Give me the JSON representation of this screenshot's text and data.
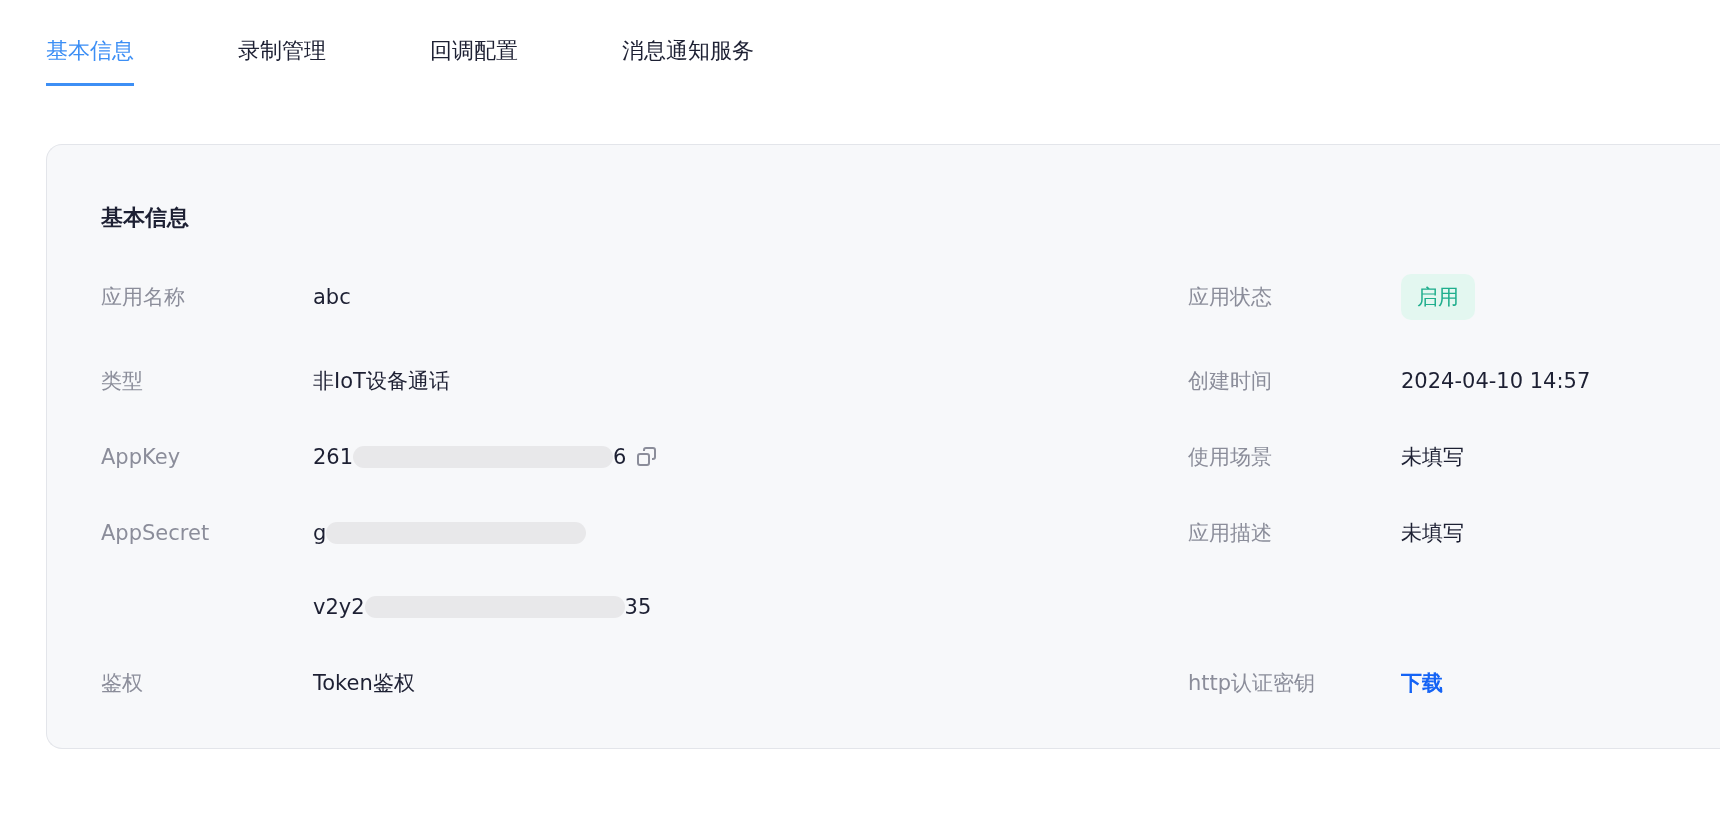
{
  "tabs": [
    {
      "label": "基本信息",
      "selected": true
    },
    {
      "label": "录制管理",
      "selected": false
    },
    {
      "label": "回调配置",
      "selected": false
    },
    {
      "label": "消息通知服务",
      "selected": false
    }
  ],
  "section": {
    "title": "基本信息",
    "left_fields": [
      {
        "kind": "text",
        "label": "应用名称",
        "value": "abc"
      },
      {
        "kind": "text",
        "label": "类型",
        "value": "非IoT设备通话"
      },
      {
        "kind": "redacted",
        "label": "AppKey",
        "copyable": true,
        "lines": [
          {
            "start": "261",
            "end": "6"
          }
        ]
      },
      {
        "kind": "redacted",
        "label": "AppSecret",
        "copyable": false,
        "lines": [
          {
            "start": "g"
          },
          {
            "start": "v2y2",
            "end": "35"
          }
        ]
      },
      {
        "kind": "text",
        "label": "鉴权",
        "value": "Token鉴权"
      }
    ],
    "right_fields": [
      {
        "kind": "badge",
        "label": "应用状态",
        "value": "启用"
      },
      {
        "kind": "text",
        "label": "创建时间",
        "value": "2024-04-10 14:57"
      },
      {
        "kind": "text",
        "label": "使用场景",
        "value": "未填写"
      },
      {
        "kind": "text",
        "label": "应用描述",
        "value": "未填写"
      },
      {
        "kind": "link",
        "label": "http认证密钥",
        "value": "下载"
      }
    ]
  }
}
